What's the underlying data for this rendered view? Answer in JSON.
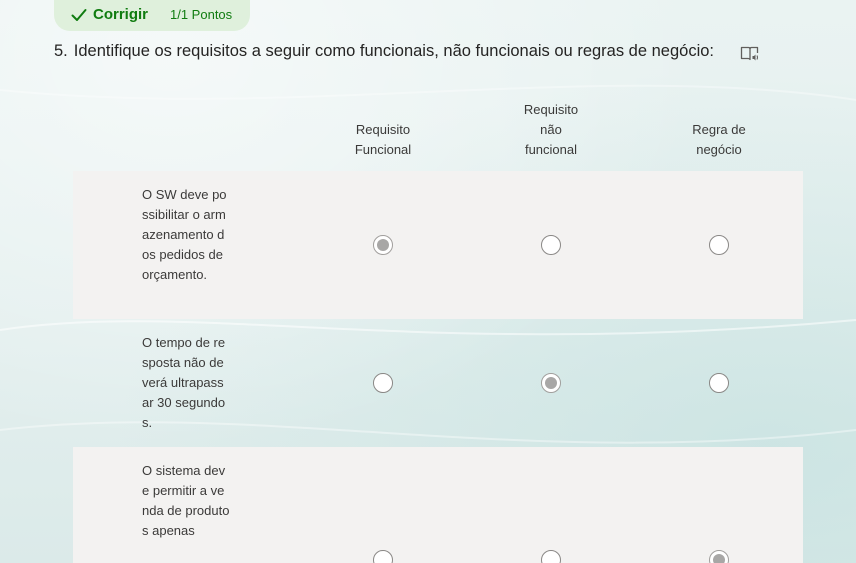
{
  "result": {
    "status": "Corrigir",
    "points": "1/1 Pontos",
    "accent_color": "#107c10",
    "badge_color": "#dff0dc"
  },
  "question": {
    "number": "5.",
    "text": "Identifique os requisitos a seguir como funcionais, não funcionais ou regras de negócio:",
    "reader_icon": "immersive-reader-icon"
  },
  "columns": [
    "Requisito Funcional",
    "Requisito não funcional",
    "Regra de negócio"
  ],
  "rows": [
    {
      "label": "O SW deve possibilitar o armazenamento dos pedidos de orçamento.",
      "selected": "Requisito Funcional"
    },
    {
      "label": "O tempo de resposta não deverá ultrapassar 30 segundos.",
      "selected": "Requisito não funcional"
    },
    {
      "label": "O sistema deve permitir a venda de produtos apenas",
      "selected": "Regra de negócio"
    }
  ]
}
